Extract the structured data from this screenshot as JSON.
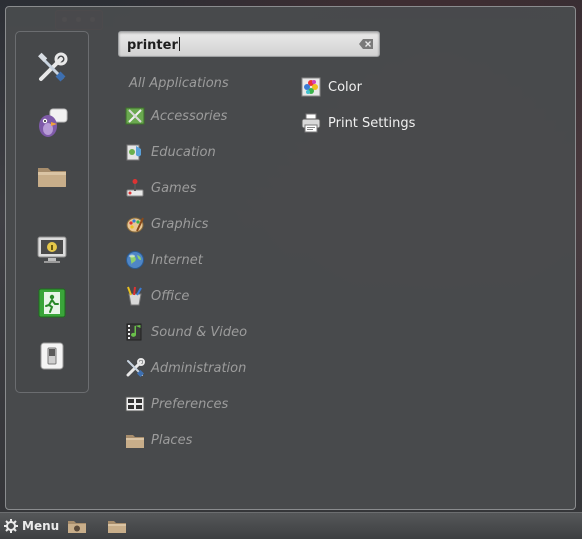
{
  "search": {
    "value": "printer"
  },
  "favorites": [
    {
      "name": "preferences-tools",
      "icon": "tools-icon"
    },
    {
      "name": "pidgin-chat",
      "icon": "chat-bird-icon"
    },
    {
      "name": "home-folder",
      "icon": "folder-icon"
    },
    {
      "name": "lock-screen",
      "icon": "monitor-lock-icon"
    },
    {
      "name": "logout",
      "icon": "exit-door-icon"
    },
    {
      "name": "shutdown",
      "icon": "power-switch-icon"
    }
  ],
  "categories": {
    "all": "All Applications",
    "items": [
      {
        "label": "Accessories",
        "icon": "accessories-icon"
      },
      {
        "label": "Education",
        "icon": "education-icon"
      },
      {
        "label": "Games",
        "icon": "games-icon"
      },
      {
        "label": "Graphics",
        "icon": "graphics-icon"
      },
      {
        "label": "Internet",
        "icon": "internet-icon"
      },
      {
        "label": "Office",
        "icon": "office-icon"
      },
      {
        "label": "Sound & Video",
        "icon": "sound-video-icon"
      },
      {
        "label": "Administration",
        "icon": "administration-icon"
      },
      {
        "label": "Preferences",
        "icon": "preferences-icon"
      },
      {
        "label": "Places",
        "icon": "places-icon"
      }
    ]
  },
  "results": [
    {
      "label": "Color",
      "icon": "color-icon"
    },
    {
      "label": "Print Settings",
      "icon": "printer-icon"
    }
  ],
  "panel": {
    "menu_label": "Menu"
  },
  "colors": {
    "menu_bg": "#494b4d",
    "category_text": "#9c9c9c",
    "app_text": "#f0f0f0"
  }
}
